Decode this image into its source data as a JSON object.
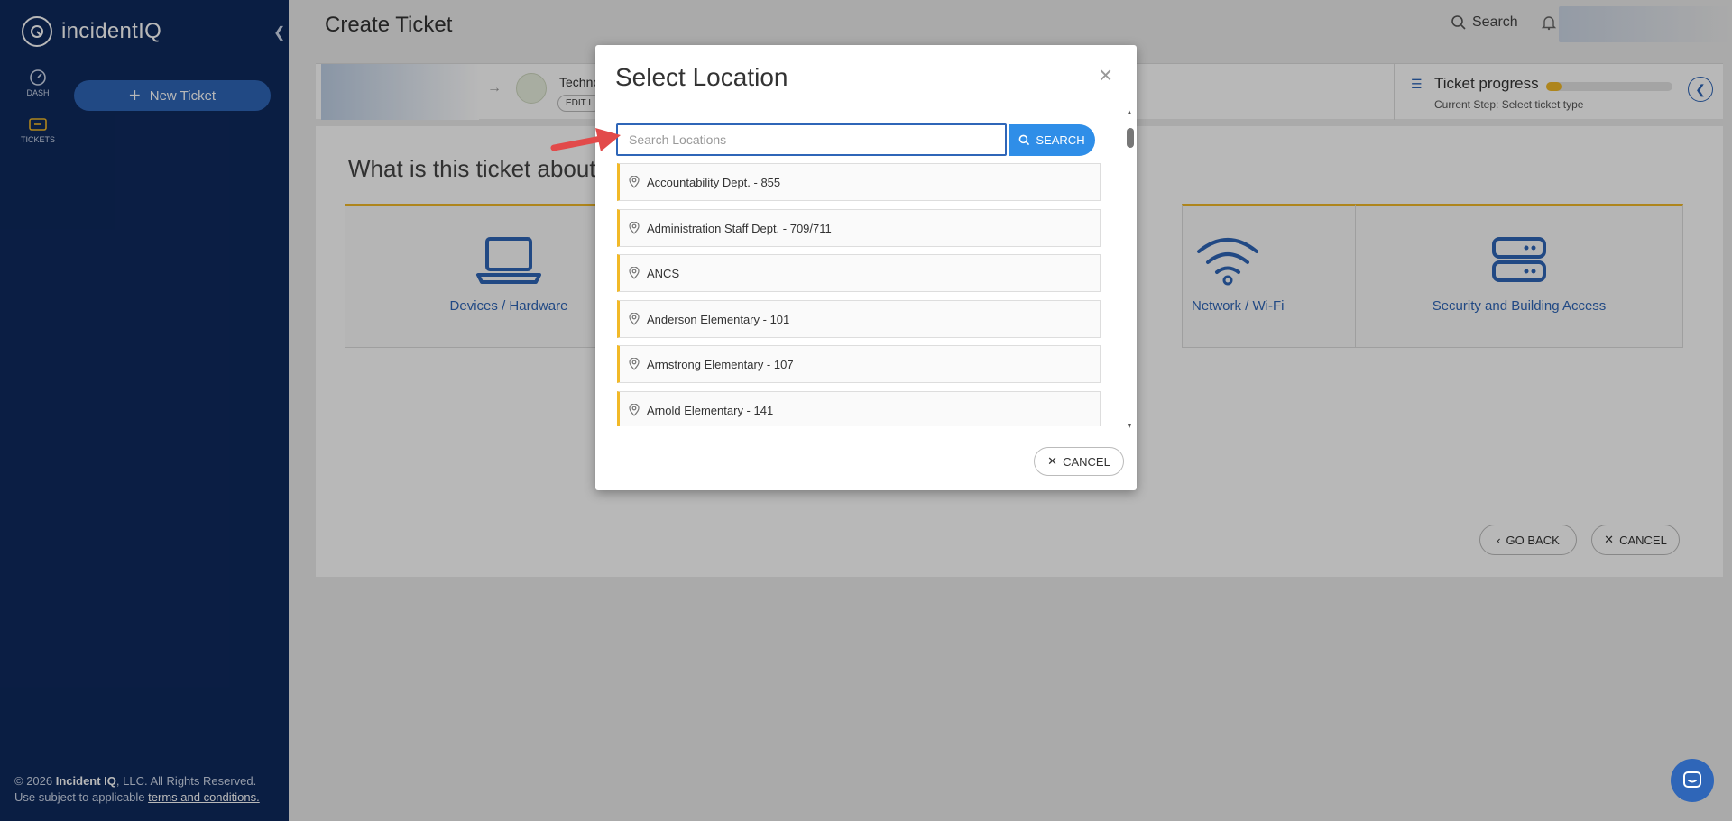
{
  "sidebar": {
    "logo_text": "incidentIQ",
    "nav": [
      {
        "label": "DASH",
        "icon": "dashboard-icon"
      },
      {
        "label": "TICKETS",
        "icon": "ticket-icon"
      }
    ],
    "new_ticket_label": "New Ticket",
    "footer": {
      "copyright_prefix": "© 2026 ",
      "company": "Incident IQ",
      "copyright_suffix": ", LLC. All Rights Reserved.",
      "use_text": "Use subject to applicable ",
      "terms_link": "terms and conditions."
    }
  },
  "header": {
    "page_title": "Create Ticket",
    "search_label": "Search"
  },
  "step_bar": {
    "location_name": "Techno",
    "edit_label": "EDIT L",
    "progress_title": "Ticket progress",
    "progress_fraction": 0.12,
    "current_step": "Current Step:  Select ticket type"
  },
  "content": {
    "question": "What is this ticket about?",
    "cards": [
      {
        "label": "Devices / Hardware",
        "icon": "laptop-icon"
      },
      {
        "label": "Network / Wi-Fi",
        "icon": "wifi-icon"
      },
      {
        "label": "Security and Building Access",
        "icon": "server-icon"
      }
    ],
    "go_back_label": "GO BACK",
    "cancel_label": "CANCEL"
  },
  "modal": {
    "title": "Select Location",
    "search_placeholder": "Search Locations",
    "search_value": "",
    "search_button": "SEARCH",
    "locations": [
      "Accountability Dept. - 855",
      "Administration Staff Dept. - 709/711",
      "ANCS",
      "Anderson Elementary - 101",
      "Armstrong Elementary - 107",
      "Arnold Elementary - 141"
    ],
    "cancel_label": "CANCEL"
  },
  "colors": {
    "sidebar_bg": "#0f2a5e",
    "accent_blue": "#2f66b8",
    "search_button": "#2f8ee8",
    "card_accent": "#f2b928",
    "annotation_arrow": "#e24a4a"
  }
}
